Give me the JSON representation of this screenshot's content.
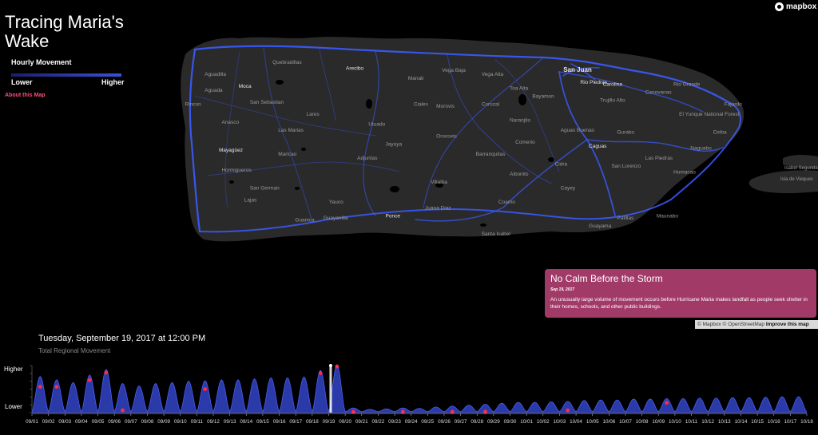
{
  "title": "Tracing Maria's Wake",
  "legend": {
    "label": "Hourly Movement",
    "low": "Lower",
    "high": "Higher"
  },
  "about_link": "About this Map",
  "brand": "mapbox",
  "story": {
    "title": "No Calm Before the Storm",
    "date": "Sep 19, 2017",
    "body": "An unusually large volume of movement occurs before Hurricane Maria makes landfall as people seek shelter in their homes, schools, and other public buildings."
  },
  "attribution": {
    "mapbox": "© Mapbox",
    "osm": "© OpenStreetMap",
    "improve": "Improve this map"
  },
  "timeline": {
    "datetime": "Tuesday, September 19, 2017 at 12:00 PM",
    "subtitle": "Total Regional Movement"
  },
  "places": [
    {
      "name": "San Juan",
      "lx": 0.675,
      "ly": 0.16
    },
    {
      "name": "Rio Piedras",
      "lx": 0.705,
      "ly": 0.22
    },
    {
      "name": "Carolina",
      "lx": 0.745,
      "ly": 0.23
    },
    {
      "name": "Arecibo",
      "lx": 0.29,
      "ly": 0.15
    },
    {
      "name": "Quebradillas",
      "lx": 0.16,
      "ly": 0.12
    },
    {
      "name": "Aguadilla",
      "lx": 0.04,
      "ly": 0.18
    },
    {
      "name": "Moca",
      "lx": 0.1,
      "ly": 0.24
    },
    {
      "name": "Aguada",
      "lx": 0.04,
      "ly": 0.26
    },
    {
      "name": "Rincon",
      "lx": 0.005,
      "ly": 0.33
    },
    {
      "name": "Anasco",
      "lx": 0.07,
      "ly": 0.42
    },
    {
      "name": "San Sebastian",
      "lx": 0.12,
      "ly": 0.32
    },
    {
      "name": "Lares",
      "lx": 0.22,
      "ly": 0.38
    },
    {
      "name": "Las Marias",
      "lx": 0.17,
      "ly": 0.46
    },
    {
      "name": "Mayagüez",
      "lx": 0.065,
      "ly": 0.56
    },
    {
      "name": "Maricao",
      "lx": 0.17,
      "ly": 0.58
    },
    {
      "name": "Hormigueros",
      "lx": 0.07,
      "ly": 0.66
    },
    {
      "name": "San German",
      "lx": 0.12,
      "ly": 0.75
    },
    {
      "name": "Lajas",
      "lx": 0.11,
      "ly": 0.81
    },
    {
      "name": "Guanica",
      "lx": 0.2,
      "ly": 0.91
    },
    {
      "name": "Utuado",
      "lx": 0.33,
      "ly": 0.43
    },
    {
      "name": "Jayuya",
      "lx": 0.36,
      "ly": 0.53
    },
    {
      "name": "Adjuntas",
      "lx": 0.31,
      "ly": 0.6
    },
    {
      "name": "Ciales",
      "lx": 0.41,
      "ly": 0.33
    },
    {
      "name": "Manati",
      "lx": 0.4,
      "ly": 0.2
    },
    {
      "name": "Vega Baja",
      "lx": 0.46,
      "ly": 0.16
    },
    {
      "name": "Vega Alta",
      "lx": 0.53,
      "ly": 0.18
    },
    {
      "name": "Morovis",
      "lx": 0.45,
      "ly": 0.34
    },
    {
      "name": "Corozal",
      "lx": 0.53,
      "ly": 0.33
    },
    {
      "name": "Toa Alta",
      "lx": 0.58,
      "ly": 0.25
    },
    {
      "name": "Bayamon",
      "lx": 0.62,
      "ly": 0.29
    },
    {
      "name": "Naranjito",
      "lx": 0.58,
      "ly": 0.41
    },
    {
      "name": "Orocovis",
      "lx": 0.45,
      "ly": 0.49
    },
    {
      "name": "Barranquitas",
      "lx": 0.52,
      "ly": 0.58
    },
    {
      "name": "Comerio",
      "lx": 0.59,
      "ly": 0.52
    },
    {
      "name": "Aguas Buenas",
      "lx": 0.67,
      "ly": 0.46
    },
    {
      "name": "Caguas",
      "lx": 0.72,
      "ly": 0.54
    },
    {
      "name": "Gurabo",
      "lx": 0.77,
      "ly": 0.47
    },
    {
      "name": "Trujillo Alto",
      "lx": 0.74,
      "ly": 0.31
    },
    {
      "name": "Canovanas",
      "lx": 0.82,
      "ly": 0.27
    },
    {
      "name": "Rio Grande",
      "lx": 0.87,
      "ly": 0.23
    },
    {
      "name": "Fajardo",
      "lx": 0.96,
      "ly": 0.33
    },
    {
      "name": "El Yunque National Forest",
      "lx": 0.88,
      "ly": 0.38
    },
    {
      "name": "Ceiba",
      "lx": 0.94,
      "ly": 0.47
    },
    {
      "name": "Naguabo",
      "lx": 0.9,
      "ly": 0.55
    },
    {
      "name": "Las Piedras",
      "lx": 0.82,
      "ly": 0.6
    },
    {
      "name": "Humacao",
      "lx": 0.87,
      "ly": 0.67
    },
    {
      "name": "San Lorenzo",
      "lx": 0.76,
      "ly": 0.64
    },
    {
      "name": "Cidra",
      "lx": 0.66,
      "ly": 0.63
    },
    {
      "name": "Cayey",
      "lx": 0.67,
      "ly": 0.75
    },
    {
      "name": "Aibonito",
      "lx": 0.58,
      "ly": 0.68
    },
    {
      "name": "Coamo",
      "lx": 0.56,
      "ly": 0.82
    },
    {
      "name": "Villalba",
      "lx": 0.44,
      "ly": 0.72
    },
    {
      "name": "Juana Diaz",
      "lx": 0.43,
      "ly": 0.85
    },
    {
      "name": "Ponce",
      "lx": 0.36,
      "ly": 0.89
    },
    {
      "name": "Yauco",
      "lx": 0.26,
      "ly": 0.82
    },
    {
      "name": "Guayanilla",
      "lx": 0.25,
      "ly": 0.9
    },
    {
      "name": "Santa Isabel",
      "lx": 0.53,
      "ly": 0.98
    },
    {
      "name": "Guayama",
      "lx": 0.72,
      "ly": 0.94
    },
    {
      "name": "Patillas",
      "lx": 0.77,
      "ly": 0.9
    },
    {
      "name": "Maunabo",
      "lx": 0.84,
      "ly": 0.89
    }
  ],
  "islands": [
    {
      "name": "Isabel Segunda"
    },
    {
      "name": "Isla de Vieques"
    }
  ],
  "chart_data": {
    "type": "area",
    "ylabels": [
      "Higher",
      "Lower"
    ],
    "x": [
      "09/01",
      "09/02",
      "09/03",
      "09/04",
      "09/05",
      "09/06",
      "09/07",
      "09/08",
      "09/09",
      "09/10",
      "09/11",
      "09/12",
      "09/13",
      "09/14",
      "09/15",
      "09/16",
      "09/17",
      "09/18",
      "09/19",
      "09/20",
      "09/21",
      "09/22",
      "09/23",
      "09/24",
      "09/25",
      "09/26",
      "09/27",
      "09/28",
      "09/29",
      "09/30",
      "10/01",
      "10/02",
      "10/03",
      "10/04",
      "10/05",
      "10/06",
      "10/07",
      "10/08",
      "10/09",
      "10/10",
      "10/11",
      "10/12",
      "10/13",
      "10/14",
      "10/15",
      "10/16",
      "10/17",
      "10/18"
    ],
    "daily_peak": [
      0.75,
      0.68,
      0.62,
      0.78,
      0.9,
      0.6,
      0.55,
      0.6,
      0.62,
      0.65,
      0.66,
      0.68,
      0.68,
      0.7,
      0.72,
      0.72,
      0.74,
      0.88,
      1.0,
      0.08,
      0.05,
      0.06,
      0.08,
      0.07,
      0.1,
      0.12,
      0.14,
      0.16,
      0.18,
      0.2,
      0.2,
      0.21,
      0.22,
      0.24,
      0.25,
      0.25,
      0.27,
      0.27,
      0.28,
      0.28,
      0.29,
      0.29,
      0.3,
      0.3,
      0.31,
      0.32,
      0.32,
      0.32
    ],
    "current": "09/19",
    "events": [
      {
        "date": "09/01",
        "level": 0.55
      },
      {
        "date": "09/02",
        "level": 0.55
      },
      {
        "date": "09/04",
        "level": 0.69
      },
      {
        "date": "09/05",
        "level": 0.85
      },
      {
        "date": "09/06",
        "level": 0.05
      },
      {
        "date": "09/11",
        "level": 0.5
      },
      {
        "date": "09/18",
        "level": 0.84
      },
      {
        "date": "09/19",
        "level": 0.98
      },
      {
        "date": "09/20",
        "level": 0.02
      },
      {
        "date": "09/23",
        "level": 0.02
      },
      {
        "date": "09/26",
        "level": 0.02
      },
      {
        "date": "09/28",
        "level": 0.02
      },
      {
        "date": "10/03",
        "level": 0.05
      },
      {
        "date": "10/09",
        "level": 0.21
      }
    ]
  }
}
